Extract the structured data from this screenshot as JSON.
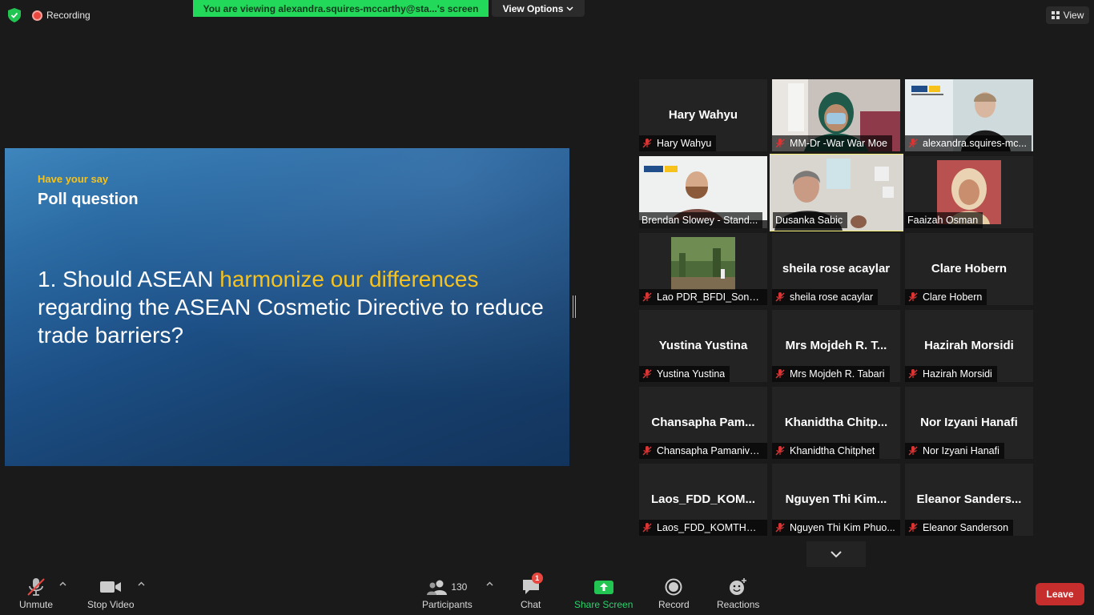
{
  "topbar": {
    "recording_label": "Recording",
    "viewing_banner": "You are viewing alexandra.squires-mccarthy@sta...'s screen",
    "view_options_label": "View Options",
    "view_label": "View"
  },
  "slide": {
    "kicker": "Have your say",
    "heading": "Poll question",
    "question_part1": "1. Should ASEAN ",
    "question_highlight": "harmonize our differences",
    "question_part2": " regarding the ASEAN Cosmetic Directive to reduce trade barriers?"
  },
  "gallery": {
    "tiles": [
      {
        "name": "Hary Wahyu",
        "label": "Hary Wahyu"
      },
      {
        "name": "",
        "label": "MM-Dr -War War Moe"
      },
      {
        "name": "",
        "label": "alexandra.squires-mc..."
      },
      {
        "name": "",
        "label": "Brendan Slowey - Stand..."
      },
      {
        "name": "",
        "label": "Dusanka Sabic"
      },
      {
        "name": "",
        "label": "Faaizah Osman"
      },
      {
        "name": "",
        "label": "Lao PDR_BFDI_Soneth..."
      },
      {
        "name": "sheila rose acaylar",
        "label": "sheila rose acaylar"
      },
      {
        "name": "Clare Hobern",
        "label": "Clare Hobern"
      },
      {
        "name": "Yustina Yustina",
        "label": "Yustina Yustina"
      },
      {
        "name": "Mrs Mojdeh R. T...",
        "label": "Mrs Mojdeh R. Tabari"
      },
      {
        "name": "Hazirah Morsidi",
        "label": "Hazirah Morsidi"
      },
      {
        "name": "Chansapha Pam...",
        "label": "Chansapha Pamanivo..."
      },
      {
        "name": "Khanidtha Chitp...",
        "label": "Khanidtha Chitphet"
      },
      {
        "name": "Nor Izyani Hanafi",
        "label": "Nor Izyani Hanafi"
      },
      {
        "name": "Laos_FDD_KOM...",
        "label": "Laos_FDD_KOMTHAM..."
      },
      {
        "name": "Nguyen Thi Kim...",
        "label": "Nguyen Thi Kim Phuo..."
      },
      {
        "name": "Eleanor Sanders...",
        "label": "Eleanor Sanderson"
      }
    ]
  },
  "toolbar": {
    "unmute": "Unmute",
    "stop_video": "Stop Video",
    "participants": "Participants",
    "participants_count": "130",
    "chat": "Chat",
    "chat_badge": "1",
    "share_screen": "Share Screen",
    "record": "Record",
    "reactions": "Reactions",
    "leave": "Leave"
  },
  "colors": {
    "share_green": "#28d46a",
    "banner_green": "#23d959",
    "leave_red": "#c62d2d",
    "highlight_yellow": "#f6c21b",
    "active_speaker": "#f3ec77"
  }
}
